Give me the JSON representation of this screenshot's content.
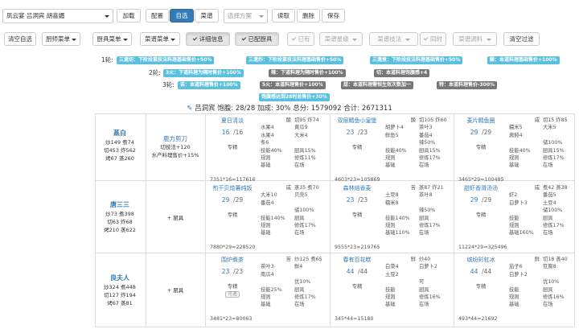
{
  "toolbar1": {
    "chef_select": "凤云宴 吕洞宾 胡喜媚",
    "load": "加载",
    "config": "配置",
    "self_select": "自选",
    "recipe": "菜谱",
    "scheme_select": "选择方案",
    "read": "读取",
    "delete": "删除",
    "save": "保存"
  },
  "toolbar2": {
    "clear_self": "清空自选",
    "chef_menu": "厨师菜单",
    "equip_menu": "厨具菜单",
    "recipe_menu": "菜谱菜单",
    "detail": "详细信息",
    "equipped": "已配厨具",
    "owned": "已有",
    "recipe_rarity": "菜谱星级",
    "recipe_skill": "菜谱技法",
    "same_time": "同时",
    "recipe_seasoning": "菜谱调料",
    "clear_filter": "清空过滤"
  },
  "rounds": [
    {
      "label": "1轮:",
      "chips": [
        "三遗切：下阶段素技法料理基础售价+50%",
        "三遗炸：下阶段素技法料理基础售价+50%",
        "三遗煮：下阶段技法料理基础售价+50%",
        "酸：本道料理基础售价+100%"
      ]
    },
    {
      "label": "2轮:",
      "chips": [
        "3火：下道料理为隔时售价+100%",
        "辣：下道料理为隔时售价+100%",
        "切：本道料理饱腹感+4"
      ]
    },
    {
      "label": "3轮:",
      "chips": [
        "苦：本道料理售价+100%",
        "5火：本道料理售价+100%",
        "甜：本道料理需恒生效次数加一",
        "特：本道料理售价-300%"
      ]
    }
  ],
  "extra_chip": "饱腹感达到28时总售价+30%",
  "summary": "吕洞宾 饱腹: 28/28 加成: 30% 总分: 1579092 合计: 2671311",
  "chefs": [
    {
      "name": "蒸白",
      "stats": [
        "炒149 煮74",
        "切453 炸562",
        "烤67 蒸260"
      ]
    },
    {
      "name": "唐三三",
      "stats": [
        "炒73 煮398",
        "切63 炸68",
        "烤210 蒸622"
      ]
    },
    {
      "name": "良夫人",
      "stats": [
        "炒324 煮448",
        "切127 炸194",
        "烤67 蒸81"
      ]
    }
  ],
  "equips": [
    {
      "name": "鹿力剪刀",
      "lines": [
        "切技法+120",
        "水产料理售价+15%"
      ]
    },
    {
      "name": "",
      "lines": [
        "+ 厨具"
      ]
    },
    {
      "name": "",
      "lines": [
        "+ 厨具"
      ]
    }
  ],
  "recipes": [
    [
      {
        "title": "夏日清淡",
        "qty": "16",
        "max": "/16",
        "spec": "专精",
        "formula": "7351*16=117616",
        "cols": [
          [
            "酸",
            "切95 炸74"
          ],
          [
            "水果4",
            "黄瓜9"
          ],
          [
            "水果4",
            "大米4"
          ],
          [
            "条6",
            ""
          ],
          [
            "技能40%",
            "厨具15%"
          ],
          [
            "规则",
            "修炼11%"
          ],
          [
            "基础",
            "在场"
          ]
        ]
      },
      {
        "title": "双层鳕鱼小皇堡",
        "qty": "23",
        "max": "/23",
        "spec": "专精",
        "formula": "4603*23=105869",
        "cols": [
          [
            "酸",
            "切105 炸60"
          ],
          [
            "胡萝卜4",
            "茶叶3"
          ],
          [
            "鲜鱼5",
            "番茄4"
          ],
          [
            "",
            "辣50%"
          ],
          [
            "技能40%",
            "厨具15%"
          ],
          [
            "规则",
            "修炼17%"
          ],
          [
            "基础",
            "在场"
          ]
        ]
      },
      {
        "title": "麦片鳕鱼圈",
        "qty": "29",
        "max": "/29",
        "spec": "专精",
        "formula": "3465*29=100485",
        "cols": [
          [
            "咸",
            "切15 炸85"
          ],
          [
            "糯米5",
            "大米5"
          ],
          [
            "酱鲱4",
            ""
          ],
          [
            "",
            "储100%"
          ],
          [
            "技能40%",
            "厨具15%"
          ],
          [
            "规则",
            "修炼17%"
          ],
          [
            "基础",
            "在场"
          ]
        ]
      }
    ],
    [
      {
        "title": "煎干贝烩薯炖饭",
        "qty": "29",
        "max": "/29",
        "spec": "专精",
        "formula": "7880*29=228520",
        "cols": [
          [
            "咸",
            "蒸35 煮70"
          ],
          [
            "大米10",
            "贝壳5"
          ],
          [
            "番茄4",
            ""
          ],
          [
            "",
            "储100%"
          ],
          [
            "技能140%",
            "厨具"
          ],
          [
            "规则",
            "修炼17%"
          ],
          [
            "基础",
            "在场"
          ]
        ]
      },
      {
        "title": "森林焙香麦",
        "qty": "23",
        "max": "/23",
        "spec": "专精",
        "formula": "9555*23=219765",
        "cols": [
          [
            "苦",
            "蒸87 炸21"
          ],
          [
            "土豆8",
            "茶叶8"
          ],
          [
            "糯米8",
            ""
          ],
          [
            "",
            "辣50%"
          ],
          [
            "技能140%",
            "厨具"
          ],
          [
            "规则",
            "修炼17%"
          ],
          [
            "基础110%",
            "在场"
          ]
        ]
      },
      {
        "title": "甜虾香滑汤汤",
        "qty": "29",
        "max": "/29",
        "spec": "专精",
        "formula": "11224*29=325496",
        "cols": [
          [
            "咸",
            "煮42 蒸38"
          ],
          [
            "虾2",
            "番茄5"
          ],
          [
            "白萝卜3",
            "土豆4"
          ],
          [
            "",
            "储100%"
          ],
          [
            "技能",
            "厨具"
          ],
          [
            "规则",
            "修炼17%"
          ],
          [
            "基础160%",
            "在场"
          ]
        ]
      }
    ],
    [
      {
        "title": "围炉煮茶",
        "qty": "23",
        "max": "/23",
        "spec": "专精",
        "formula": "3481*23=80063",
        "cols": [
          [
            "苦",
            "炒125 煮65"
          ],
          [
            "茶叶3",
            "鲜4"
          ],
          [
            "南瓜4",
            ""
          ],
          [
            "",
            "优10%"
          ],
          [
            "技能25%",
            "厨具"
          ],
          [
            "规则",
            "修炼17%"
          ],
          [
            "基础",
            "在场"
          ]
        ]
      },
      {
        "title": "春有百花糕",
        "qty": "44",
        "max": "/44",
        "spec": "专精",
        "formula": "345*44=15180",
        "cols": [
          [
            "鲜",
            "炒40"
          ],
          [
            "白菜4",
            "白萝卜2"
          ],
          [
            "土豆2",
            ""
          ],
          [
            "",
            "可"
          ],
          [
            "技能",
            "厨具"
          ],
          [
            "规则",
            "修炼16%"
          ],
          [
            "基础",
            "在场"
          ]
        ]
      },
      {
        "title": "缤纷彩虹冰",
        "qty": "44",
        "max": "/44",
        "spec": "专精",
        "formula": "493*44=21692",
        "cols": [
          [
            "鲜",
            "切18 蒸40"
          ],
          [
            "茄子6",
            "豆腐8"
          ],
          [
            "白萝卜2",
            ""
          ],
          [
            "",
            "优10%"
          ],
          [
            "技能",
            "厨具"
          ],
          [
            "规则",
            "修炼16%"
          ],
          [
            "基础",
            "在场"
          ]
        ]
      }
    ]
  ],
  "special_badge": "可选"
}
